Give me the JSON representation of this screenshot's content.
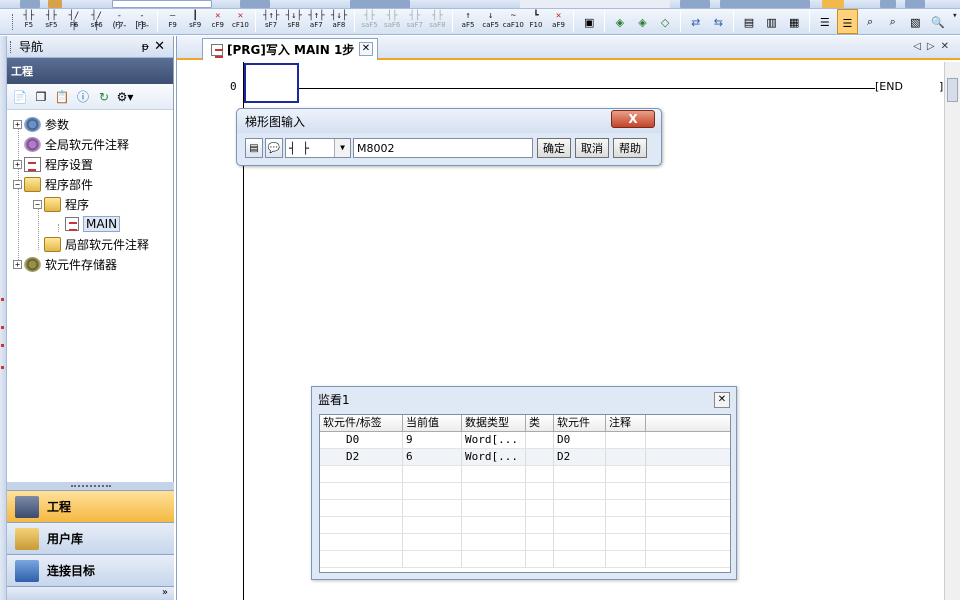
{
  "toolbar": {
    "keys": [
      "F5",
      "sF5",
      "F6",
      "sF6",
      "F7",
      "F8",
      "F9",
      "sF9",
      "cF9",
      "cF10",
      "sF7",
      "sF8",
      "aF7",
      "aF8",
      "saF5",
      "saF6",
      "saF7",
      "saF8",
      "aF5",
      "caF5",
      "caF10",
      "F10",
      "aF9"
    ]
  },
  "nav": {
    "title": "导航",
    "pin": "ᵽ",
    "close": "✕",
    "section": "工程",
    "tree": [
      {
        "label": "参数",
        "expander": "+"
      },
      {
        "label": "全局软元件注释",
        "expander": ""
      },
      {
        "label": "程序设置",
        "expander": "+"
      },
      {
        "label": "程序部件",
        "expander": "−"
      },
      {
        "label": "程序",
        "expander": "−"
      },
      {
        "label": "MAIN",
        "expander": ""
      },
      {
        "label": "局部软元件注释",
        "expander": ""
      },
      {
        "label": "软元件存储器",
        "expander": "+"
      }
    ],
    "bottom_tabs": [
      "工程",
      "用户库",
      "连接目标"
    ],
    "more": "»"
  },
  "editor": {
    "tab_label": "[PRG]写入 MAIN 1步",
    "tab_close": "✕",
    "rung_number": "0",
    "end_label": "END"
  },
  "ladder_dialog": {
    "title": "梯形图输入",
    "close": "X",
    "symbol": "┤ ├",
    "input_value": "M8002",
    "ok": "确定",
    "cancel": "取消",
    "help": "帮助"
  },
  "watch": {
    "title": "监看1",
    "close": "✕",
    "columns": [
      "软元件/标签",
      "当前值",
      "数据类型",
      "类",
      "软元件",
      "注释"
    ],
    "rows": [
      [
        "D0",
        "9",
        "Word[...",
        "",
        "D0",
        ""
      ],
      [
        "D2",
        "6",
        "Word[...",
        "",
        "D2",
        ""
      ]
    ]
  }
}
